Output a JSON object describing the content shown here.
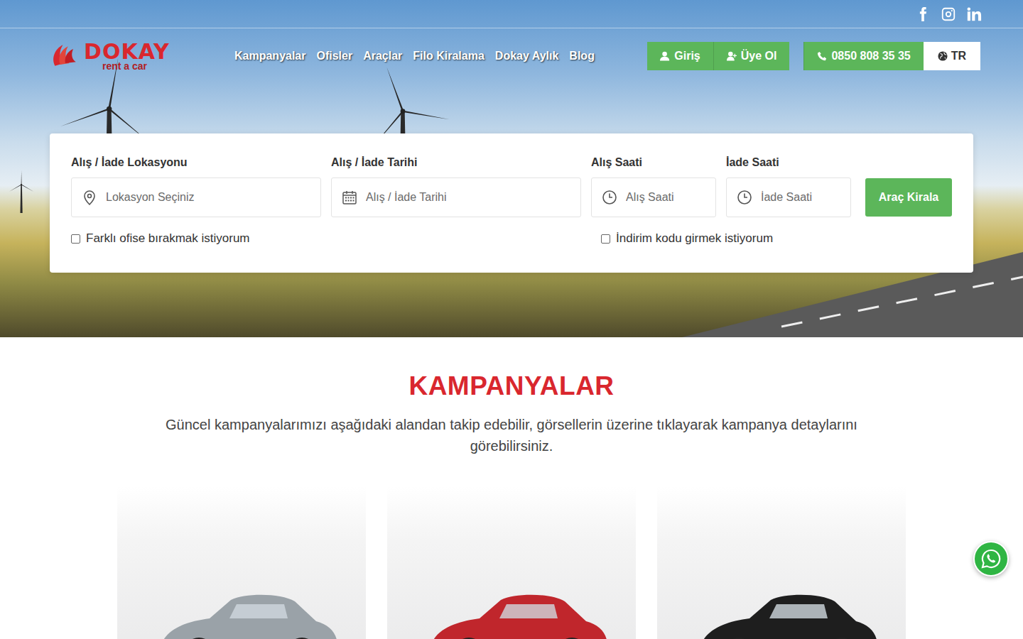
{
  "logo": {
    "name": "DOKAY",
    "tagline": "rent a car"
  },
  "nav": [
    "Kampanyalar",
    "Ofisler",
    "Araçlar",
    "Filo Kiralama",
    "Dokay Aylık",
    "Blog"
  ],
  "auth_buttons": [
    {
      "label": "Giriş",
      "kind": "login"
    },
    {
      "label": "Üye Ol",
      "kind": "register"
    }
  ],
  "phone": "0850 808 35 35",
  "language": "TR",
  "search": {
    "fields": [
      {
        "label": "Alış / İade Lokasyonu",
        "placeholder": "Lokasyon Seçiniz",
        "kind": "location"
      },
      {
        "label": "Alış / İade Tarihi",
        "placeholder": "Alış / İade Tarihi",
        "kind": "date"
      },
      {
        "label": "Alış Saati",
        "placeholder": "Alış Saati",
        "kind": "time"
      },
      {
        "label": "İade Saati",
        "placeholder": "İade Saati",
        "kind": "time"
      }
    ],
    "submit": "Araç Kirala",
    "options": [
      {
        "label": "Farklı ofise bırakmak istiyorum",
        "checked": false
      },
      {
        "label": "İndirim kodu girmek istiyorum",
        "checked": false
      }
    ]
  },
  "campaigns": {
    "title": "KAMPANYALAR",
    "description": "Güncel kampanyalarımızı aşağıdaki alandan takip edebilir, görsellerin üzerine tıklayarak kampanya detaylarını görebilirsiniz."
  }
}
